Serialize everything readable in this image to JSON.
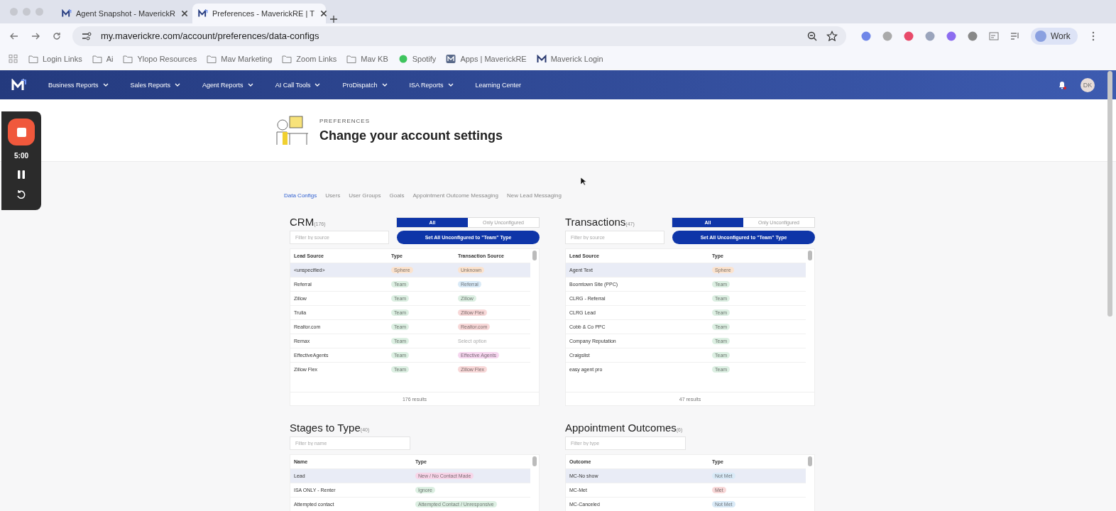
{
  "browser": {
    "tabs": [
      {
        "title": "Agent Snapshot - MaverickR",
        "selected": false
      },
      {
        "title": "Preferences - MaverickRE | T",
        "selected": true
      }
    ],
    "url": "my.maverickre.com/account/preferences/data-configs",
    "bookmarks": [
      {
        "label": "Login Links",
        "kind": "folder"
      },
      {
        "label": "Ai",
        "kind": "folder"
      },
      {
        "label": "Ylopo Resources",
        "kind": "folder"
      },
      {
        "label": "Mav Marketing",
        "kind": "folder"
      },
      {
        "label": "Zoom Links",
        "kind": "folder"
      },
      {
        "label": "Mav KB",
        "kind": "folder"
      },
      {
        "label": "Spotify",
        "kind": "spotify"
      },
      {
        "label": "Apps | MaverickRE",
        "kind": "app"
      },
      {
        "label": "Maverick Login",
        "kind": "logo"
      }
    ],
    "profile": "Work"
  },
  "nav": {
    "items": [
      {
        "label": "Business Reports",
        "dropdown": true
      },
      {
        "label": "Sales Reports",
        "dropdown": true
      },
      {
        "label": "Agent Reports",
        "dropdown": true
      },
      {
        "label": "AI Call Tools",
        "dropdown": true
      },
      {
        "label": "ProDispatch",
        "dropdown": true
      },
      {
        "label": "ISA Reports",
        "dropdown": true
      },
      {
        "label": "Learning Center",
        "dropdown": false
      }
    ],
    "avatar": "DK"
  },
  "recorder": {
    "time": "5:00"
  },
  "header": {
    "eyebrow": "PREFERENCES",
    "title": "Change your account settings"
  },
  "subtabs": [
    {
      "label": "Data Configs",
      "selected": true
    },
    {
      "label": "Users",
      "selected": false
    },
    {
      "label": "User Groups",
      "selected": false
    },
    {
      "label": "Goals",
      "selected": false
    },
    {
      "label": "Appointment Outcome Messaging",
      "selected": false
    },
    {
      "label": "New Lead Messaging",
      "selected": false
    }
  ],
  "panels": [
    {
      "title": "CRM",
      "count": "(176)",
      "toggle": [
        {
          "label": "All",
          "selected": true
        },
        {
          "label": "Only Unconfigured",
          "selected": false
        }
      ],
      "filter": {
        "placeholder": "Filter by source"
      },
      "action": "Set All Unconfigured to \"Team\" Type",
      "columns": [
        "Lead Source",
        "Type",
        "Transaction Source"
      ],
      "rows": [
        {
          "selected": true,
          "cells": [
            {
              "text": "<unspecified>"
            },
            {
              "text": "Sphere",
              "color": "#fbe3cf"
            },
            {
              "text": "Unknown",
              "color": "#fbe3cf"
            }
          ]
        },
        {
          "selected": false,
          "cells": [
            {
              "text": "Referral"
            },
            {
              "text": "Team",
              "color": "#dcefe2"
            },
            {
              "text": "Referral",
              "color": "#d9eaf7"
            }
          ]
        },
        {
          "selected": false,
          "cells": [
            {
              "text": "Zillow"
            },
            {
              "text": "Team",
              "color": "#dcefe2"
            },
            {
              "text": "Zillow",
              "color": "#dcefe2"
            }
          ]
        },
        {
          "selected": false,
          "cells": [
            {
              "text": "Trulia"
            },
            {
              "text": "Team",
              "color": "#dcefe2"
            },
            {
              "text": "Zillow Flex",
              "color": "#f8d8d8"
            }
          ]
        },
        {
          "selected": false,
          "cells": [
            {
              "text": "Realtor.com"
            },
            {
              "text": "Team",
              "color": "#dcefe2"
            },
            {
              "text": "Realtor.com",
              "color": "#f8d8d8"
            }
          ]
        },
        {
          "selected": false,
          "cells": [
            {
              "text": "Remax"
            },
            {
              "text": "Team",
              "color": "#dcefe2"
            },
            {
              "text": "Select option",
              "kind": "hint"
            }
          ]
        },
        {
          "selected": false,
          "cells": [
            {
              "text": "EffectiveAgents"
            },
            {
              "text": "Team",
              "color": "#dcefe2"
            },
            {
              "text": "Effective Agents",
              "color": "#f6d6ef"
            }
          ]
        },
        {
          "selected": false,
          "cells": [
            {
              "text": "Zillow Flex"
            },
            {
              "text": "Team",
              "color": "#dcefe2"
            },
            {
              "text": "Zillow Flex",
              "color": "#f8d8d8"
            }
          ]
        }
      ],
      "footer": "176 results"
    },
    {
      "title": "Transactions",
      "count": "(47)",
      "toggle": [
        {
          "label": "All",
          "selected": true
        },
        {
          "label": "Only Unconfigured",
          "selected": false
        }
      ],
      "filter": {
        "placeholder": "Filter by source"
      },
      "action": "Set All Unconfigured to \"Team\" Type",
      "columns": [
        "Lead Source",
        "Type"
      ],
      "rows": [
        {
          "selected": true,
          "cells": [
            {
              "text": "Agent Text"
            },
            {
              "text": "Sphere",
              "color": "#fbe3cf"
            }
          ]
        },
        {
          "selected": false,
          "cells": [
            {
              "text": "Boomtown Site (PPC)"
            },
            {
              "text": "Team",
              "color": "#dcefe2"
            }
          ]
        },
        {
          "selected": false,
          "cells": [
            {
              "text": "CLRG - Referral"
            },
            {
              "text": "Team",
              "color": "#dcefe2"
            }
          ]
        },
        {
          "selected": false,
          "cells": [
            {
              "text": "CLRG Lead"
            },
            {
              "text": "Team",
              "color": "#dcefe2"
            }
          ]
        },
        {
          "selected": false,
          "cells": [
            {
              "text": "Cobb & Co PPC"
            },
            {
              "text": "Team",
              "color": "#dcefe2"
            }
          ]
        },
        {
          "selected": false,
          "cells": [
            {
              "text": "Company Reputation"
            },
            {
              "text": "Team",
              "color": "#dcefe2"
            }
          ]
        },
        {
          "selected": false,
          "cells": [
            {
              "text": "Craigslist"
            },
            {
              "text": "Team",
              "color": "#dcefe2"
            }
          ]
        },
        {
          "selected": false,
          "cells": [
            {
              "text": "easy agent pro"
            },
            {
              "text": "Team",
              "color": "#dcefe2"
            }
          ]
        }
      ],
      "footer": "47 results"
    },
    {
      "title": "Stages to Type",
      "count": "(40)",
      "filter": {
        "placeholder": "Filter by name"
      },
      "columns": [
        "Name",
        "Type"
      ],
      "rows": [
        {
          "selected": true,
          "cells": [
            {
              "text": "Lead"
            },
            {
              "text": "New / No Contact Made",
              "color": "#f8d5e8"
            }
          ]
        },
        {
          "selected": false,
          "cells": [
            {
              "text": "ISA ONLY - Renter"
            },
            {
              "text": "Ignore",
              "color": "#dcefe2"
            }
          ]
        },
        {
          "selected": false,
          "cells": [
            {
              "text": "Attempted contact"
            },
            {
              "text": "Attempted Contact / Unresponsive",
              "color": "#dcefe2"
            }
          ]
        }
      ]
    },
    {
      "title": "Appointment Outcomes",
      "count": "(6)",
      "filter": {
        "placeholder": "Filter by type"
      },
      "columns": [
        "Outcome",
        "Type"
      ],
      "rows": [
        {
          "selected": true,
          "cells": [
            {
              "text": "MC-No show"
            },
            {
              "text": "Not Met",
              "color": "#d9eaf7"
            }
          ]
        },
        {
          "selected": false,
          "cells": [
            {
              "text": "MC-Met"
            },
            {
              "text": "Met",
              "color": "#f8d8d8"
            }
          ]
        },
        {
          "selected": false,
          "cells": [
            {
              "text": "MC-Canceled"
            },
            {
              "text": "Not Met",
              "color": "#d9eaf7"
            }
          ]
        }
      ]
    }
  ]
}
